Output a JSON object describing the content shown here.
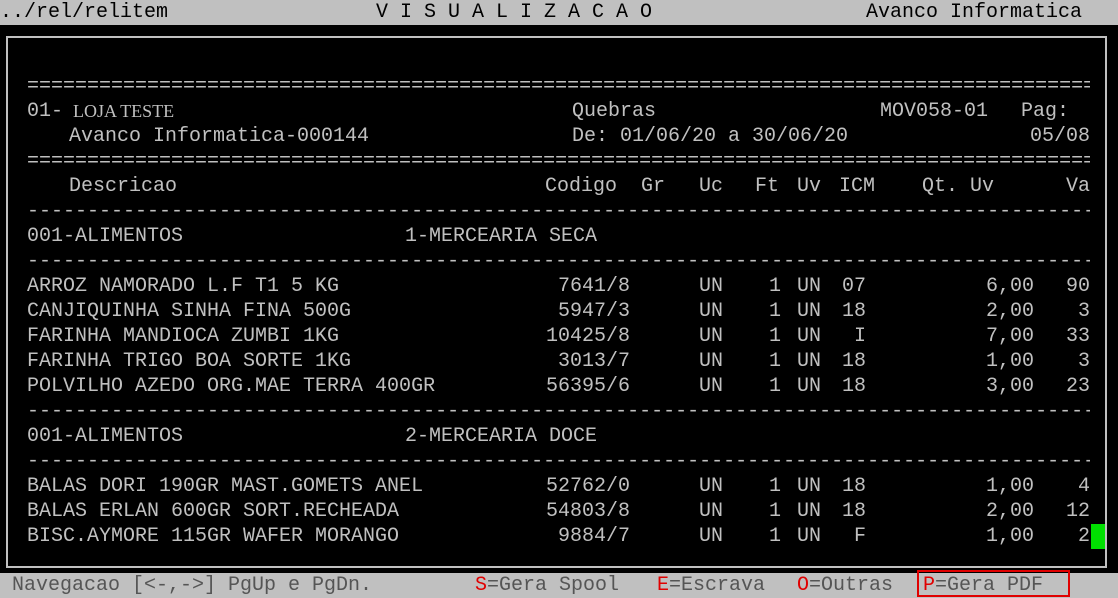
{
  "topbar": {
    "path": "../rel/relitem",
    "mode": "V I S U A L I Z A C A O",
    "company": "Avanco Informatica"
  },
  "report": {
    "separator_double": "====================================================================================================",
    "separator_single": "----------------------------------------------------------------------------------------------------",
    "store_code": "01-",
    "store_name": "LOJA TESTE",
    "title": "Quebras",
    "report_code": "MOV058-01",
    "page_label": "Pag:",
    "client": "Avanco Informatica-000144",
    "period": "De: 01/06/20 a 30/06/20",
    "page_number": "05/08"
  },
  "columns": {
    "descricao": "Descricao",
    "codigo": "Codigo",
    "gr": "Gr",
    "uc": "Uc",
    "ft": "Ft",
    "uv": "Uv",
    "icm": "ICM",
    "qt_uv": "Qt. Uv",
    "va": "Va"
  },
  "groups": [
    {
      "department": "001-ALIMENTOS",
      "section": "1-MERCEARIA SECA",
      "items": [
        {
          "descricao": "ARROZ NAMORADO L.F T1 5 KG",
          "codigo": "7641/8",
          "uc": "UN",
          "ft": "1",
          "uv": "UN",
          "icm": "07",
          "qt": "6,00",
          "va": "90"
        },
        {
          "descricao": "CANJIQUINHA SINHA FINA 500G",
          "codigo": "5947/3",
          "uc": "UN",
          "ft": "1",
          "uv": "UN",
          "icm": "18",
          "qt": "2,00",
          "va": "3"
        },
        {
          "descricao": "FARINHA MANDIOCA ZUMBI 1KG",
          "codigo": "10425/8",
          "uc": "UN",
          "ft": "1",
          "uv": "UN",
          "icm": "I",
          "qt": "7,00",
          "va": "33"
        },
        {
          "descricao": "FARINHA TRIGO BOA SORTE 1KG",
          "codigo": "3013/7",
          "uc": "UN",
          "ft": "1",
          "uv": "UN",
          "icm": "18",
          "qt": "1,00",
          "va": "3"
        },
        {
          "descricao": "POLVILHO AZEDO ORG.MAE TERRA 400GR",
          "codigo": "56395/6",
          "uc": "UN",
          "ft": "1",
          "uv": "UN",
          "icm": "18",
          "qt": "3,00",
          "va": "23"
        }
      ]
    },
    {
      "department": "001-ALIMENTOS",
      "section": "2-MERCEARIA DOCE",
      "items": [
        {
          "descricao": "BALAS DORI 190GR MAST.GOMETS ANEL",
          "codigo": "52762/0",
          "uc": "UN",
          "ft": "1",
          "uv": "UN",
          "icm": "18",
          "qt": "1,00",
          "va": "4"
        },
        {
          "descricao": "BALAS ERLAN 600GR SORT.RECHEADA",
          "codigo": "54803/8",
          "uc": "UN",
          "ft": "1",
          "uv": "UN",
          "icm": "18",
          "qt": "2,00",
          "va": "12"
        },
        {
          "descricao": "BISC.AYMORE 115GR WAFER MORANGO",
          "codigo": "9884/7",
          "uc": "UN",
          "ft": "1",
          "uv": "UN",
          "icm": "F",
          "qt": "1,00",
          "va": "2"
        }
      ]
    }
  ],
  "statusbar": {
    "navigation": "Navegacao [<-,->] PgUp e PgDn.",
    "spool_key": "S",
    "spool_label": "=Gera Spool",
    "escrava_key": "E",
    "escrava_label": "=Escrava",
    "outras_key": "O",
    "outras_label": "=Outras",
    "pdf_key": "P",
    "pdf_label": "=Gera PDF"
  },
  "colors": {
    "background": "#000000",
    "text": "#c0c0c0",
    "bar": "#c0c0c0",
    "hotkey": "#e00000",
    "cursor": "#00e000"
  }
}
